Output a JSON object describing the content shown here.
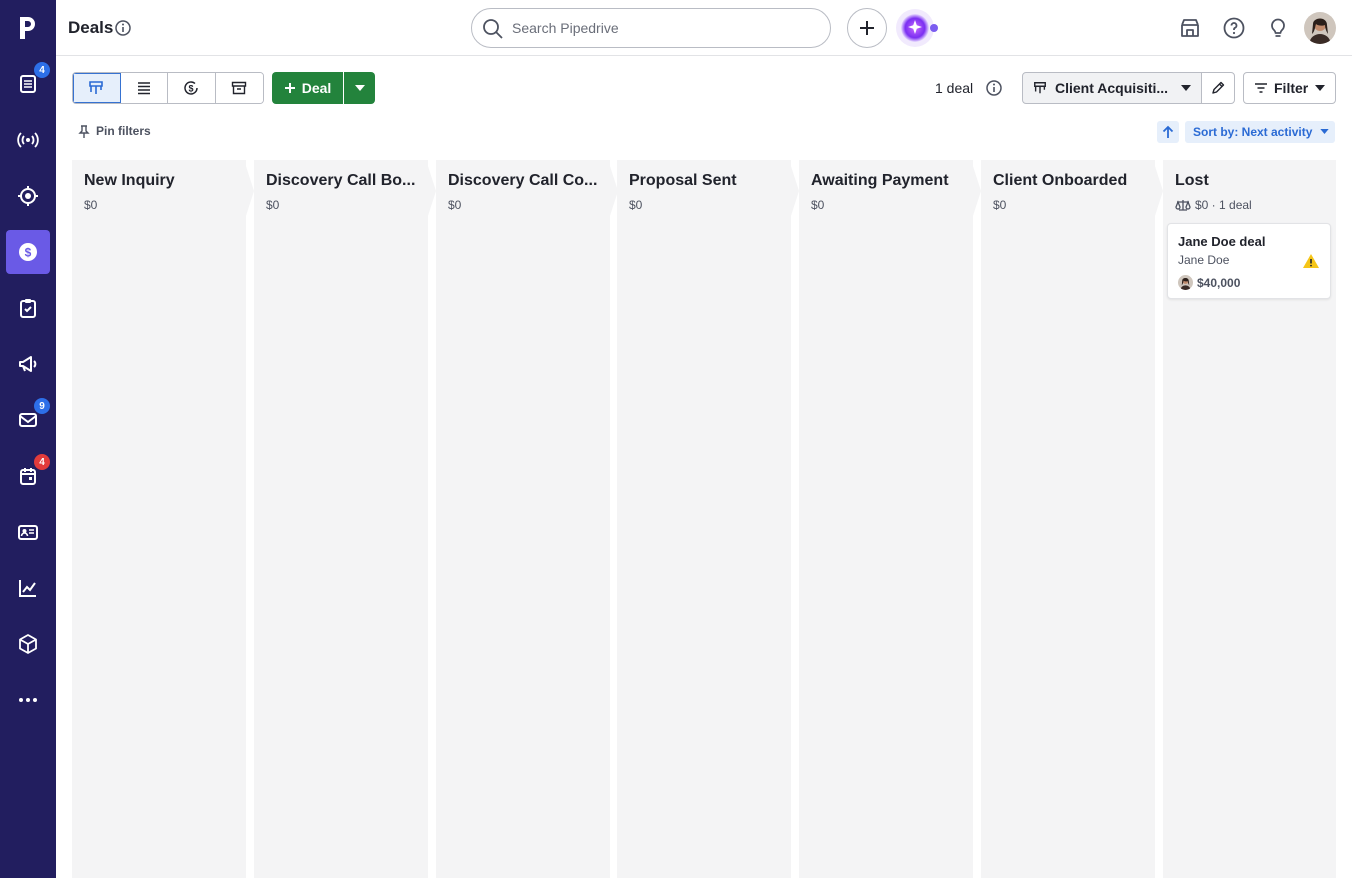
{
  "app": {
    "page_title": "Deals"
  },
  "search": {
    "placeholder": "Search Pipedrive"
  },
  "sidebar": {
    "items": [
      {
        "name": "leads-icon",
        "badge": "4",
        "badge_color": "#2d6fe8"
      },
      {
        "name": "campaigns-radio-icon"
      },
      {
        "name": "target-icon"
      },
      {
        "name": "deals-dollar-icon",
        "active": true
      },
      {
        "name": "tasks-clipboard-icon"
      },
      {
        "name": "megaphone-icon"
      },
      {
        "name": "mail-icon",
        "badge": "9",
        "badge_color": "#2d6fe8"
      },
      {
        "name": "calendar-icon",
        "badge": "4",
        "badge_color": "#e23b3b"
      },
      {
        "name": "contacts-card-icon"
      },
      {
        "name": "insights-chart-icon"
      },
      {
        "name": "products-box-icon"
      },
      {
        "name": "more-icon"
      }
    ]
  },
  "toolbar": {
    "deal_button_label": "Deal",
    "deal_count": "1 deal",
    "pipeline_label": "Client Acquisiti...",
    "filter_label": "Filter",
    "pin_filters_label": "Pin filters",
    "sort_label": "Sort by: Next activity"
  },
  "stages": [
    {
      "name": "New Inquiry",
      "sum": "$0"
    },
    {
      "name": "Discovery Call Bo...",
      "sum": "$0"
    },
    {
      "name": "Discovery Call Co...",
      "sum": "$0"
    },
    {
      "name": "Proposal Sent",
      "sum": "$0"
    },
    {
      "name": "Awaiting Payment",
      "sum": "$0"
    },
    {
      "name": "Client Onboarded",
      "sum": "$0"
    },
    {
      "name": "Lost",
      "sum": "$0 · 1 deal"
    }
  ],
  "deal_card": {
    "title": "Jane Doe deal",
    "person": "Jane Doe",
    "value": "$40,000"
  },
  "colors": {
    "sidebar_bg": "#221e5f",
    "active_nav": "#6a5ae6",
    "primary_green": "#23833c",
    "accent_blue": "#2a6ad4",
    "stage_bg": "#f4f4f5",
    "warning": "#f5c518"
  }
}
